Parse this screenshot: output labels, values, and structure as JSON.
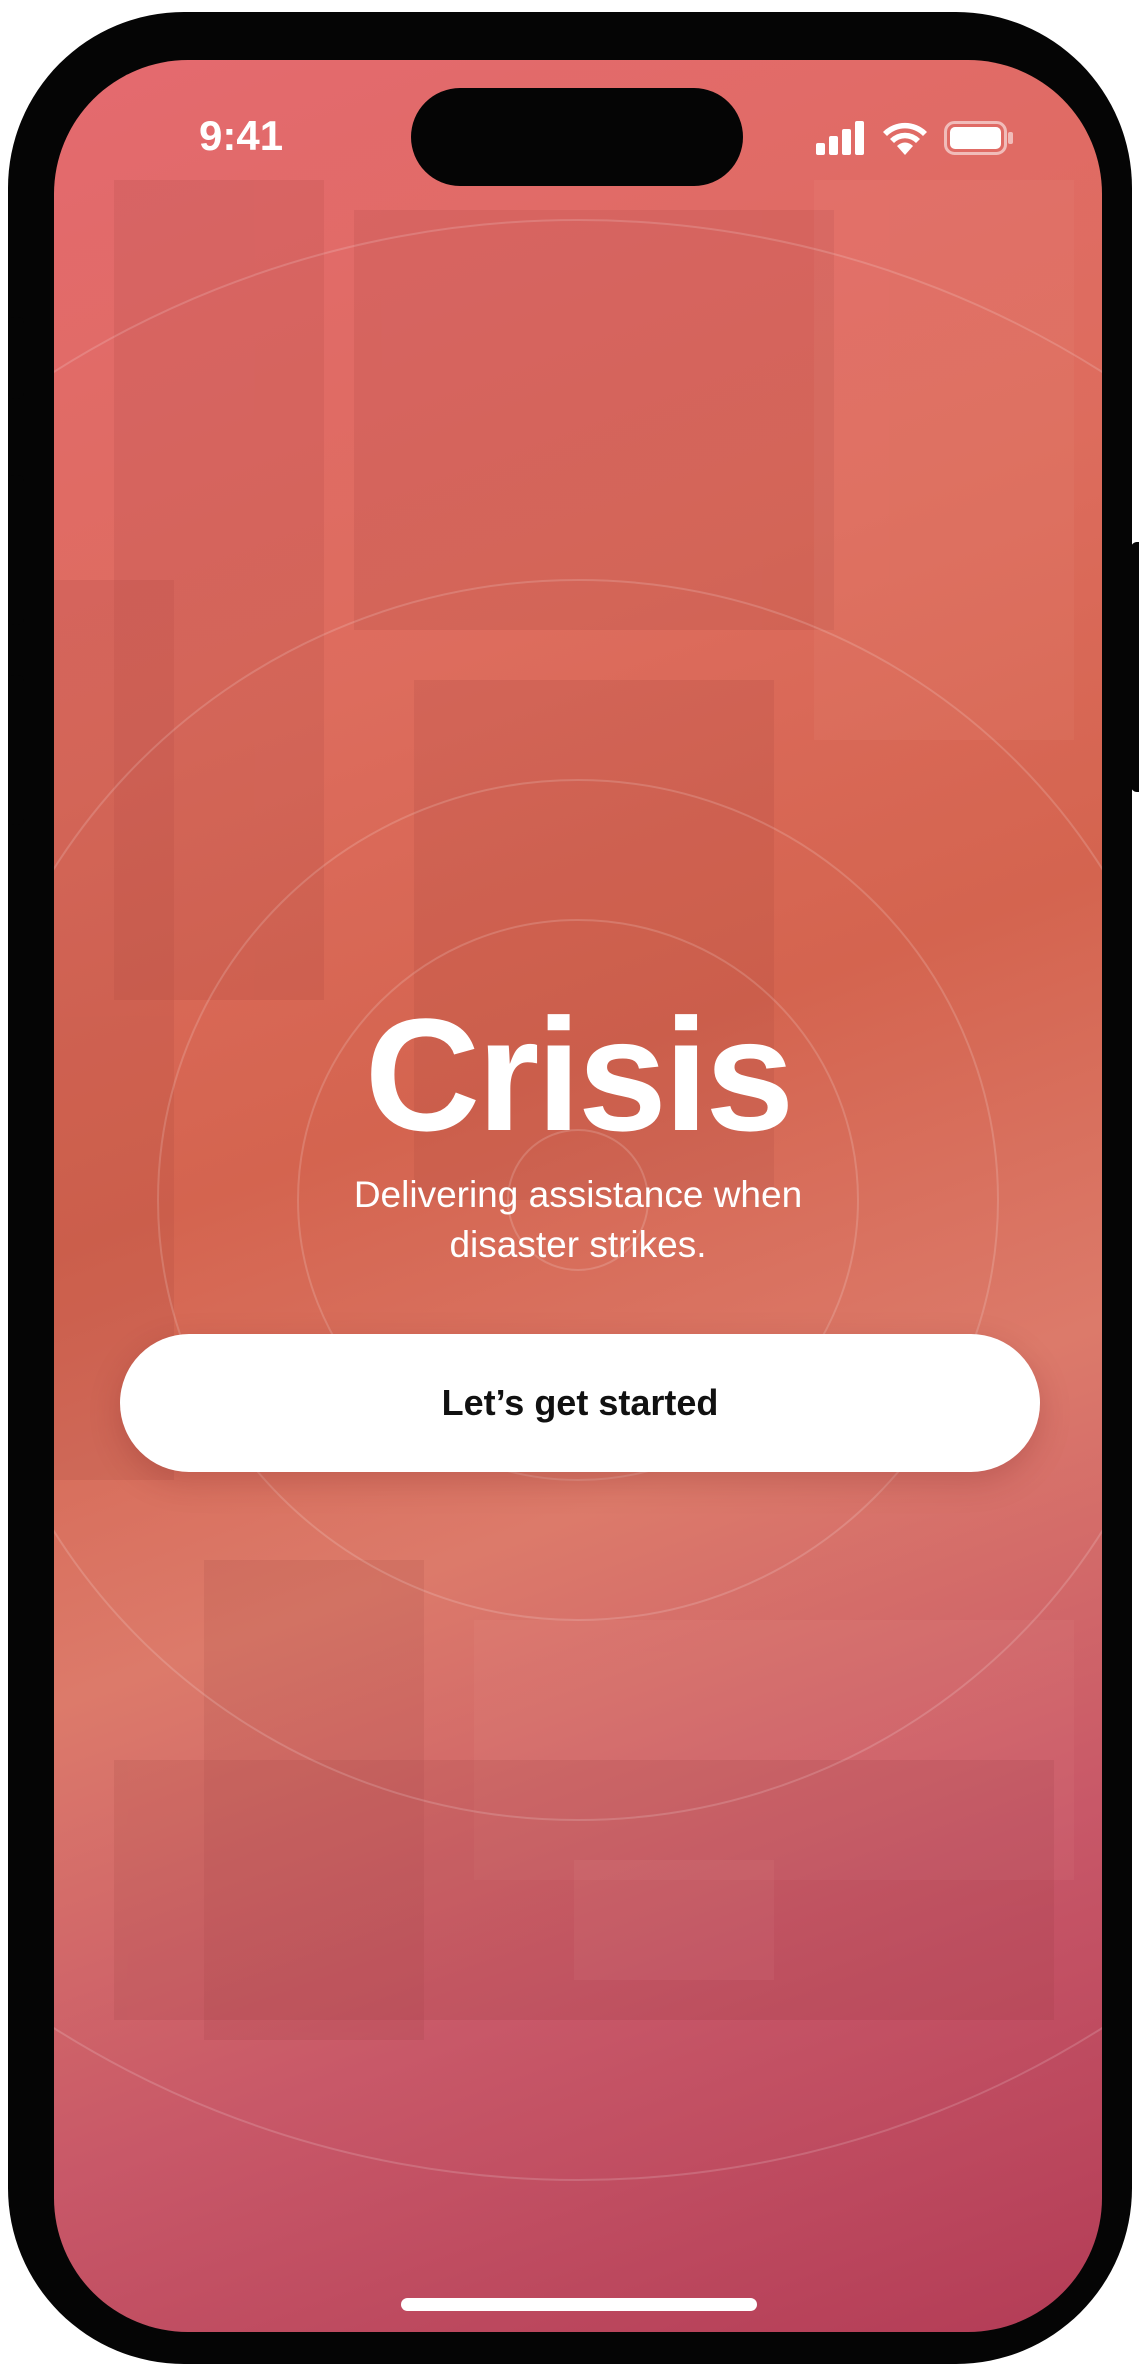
{
  "status_bar": {
    "time": "9:41",
    "icons": [
      "cellular-signal-icon",
      "wifi-icon",
      "battery-icon"
    ]
  },
  "hero": {
    "title": "Crisis",
    "tagline": "Delivering assistance when disaster strikes."
  },
  "cta": {
    "label": "Let’s get started"
  },
  "colors": {
    "gradient_top": "#e46a6f",
    "gradient_mid": "#d4644f",
    "gradient_bottom": "#b33c56",
    "button_bg": "#ffffff",
    "button_text": "#111111",
    "text": "#ffffff"
  }
}
